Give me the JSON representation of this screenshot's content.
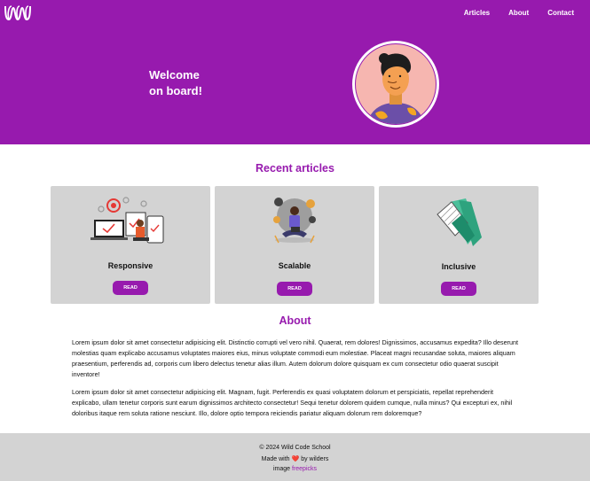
{
  "header": {
    "logo_name": "wavy-w-logo",
    "nav": [
      "Articles",
      "About",
      "Contact"
    ],
    "welcome": [
      "Welcome",
      "on board!"
    ]
  },
  "articles": {
    "title": "Recent articles",
    "cards": [
      {
        "title": "Responsive",
        "button": "READ",
        "illustration": "responsive-devices-illustration"
      },
      {
        "title": "Scalable",
        "button": "READ",
        "illustration": "scalable-meditation-illustration"
      },
      {
        "title": "Inclusive",
        "button": "READ",
        "illustration": "inclusive-hands-illustration"
      }
    ]
  },
  "about": {
    "title": "About",
    "paragraphs": [
      "Lorem ipsum dolor sit amet consectetur adipisicing elit. Distinctio corrupti vel vero nihil. Quaerat, rem dolores! Dignissimos, accusamus expedita? Illo deserunt molestias quam explicabo accusamus voluptates maiores eius, minus voluptate commodi eum molestiae. Placeat magni recusandae soluta, maiores aliquam praesentium, perferendis ad, corporis cum libero delectus tenetur alias illum. Autem dolorum dolore quisquam ex cum consectetur odio quaerat suscipit inventore!",
      "Lorem ipsum dolor sit amet consectetur adipisicing elit. Magnam, fugit. Perferendis ex quasi voluptatem dolorum et perspiciatis, repellat reprehenderit explicabo, ullam tenetur corporis sunt earum dignissimos architecto consectetur! Sequi tenetur dolorem quidem cumque, nulla minus? Qui excepturi ex, nihil doloribus itaque rem soluta ratione nesciunt. Illo, dolore optio tempora reiciendis pariatur aliquam dolorum rem doloremque?"
    ]
  },
  "footer": {
    "copyright": "© 2024 Wild Code School",
    "made_prefix": "Made with",
    "heart": "❤️",
    "made_suffix": "by wilders",
    "image_prefix": "image",
    "image_link": "freepicks"
  },
  "colors": {
    "brand": "#971aae",
    "card_bg": "#d3d3d3",
    "footer_bg": "#d3d3d3"
  }
}
